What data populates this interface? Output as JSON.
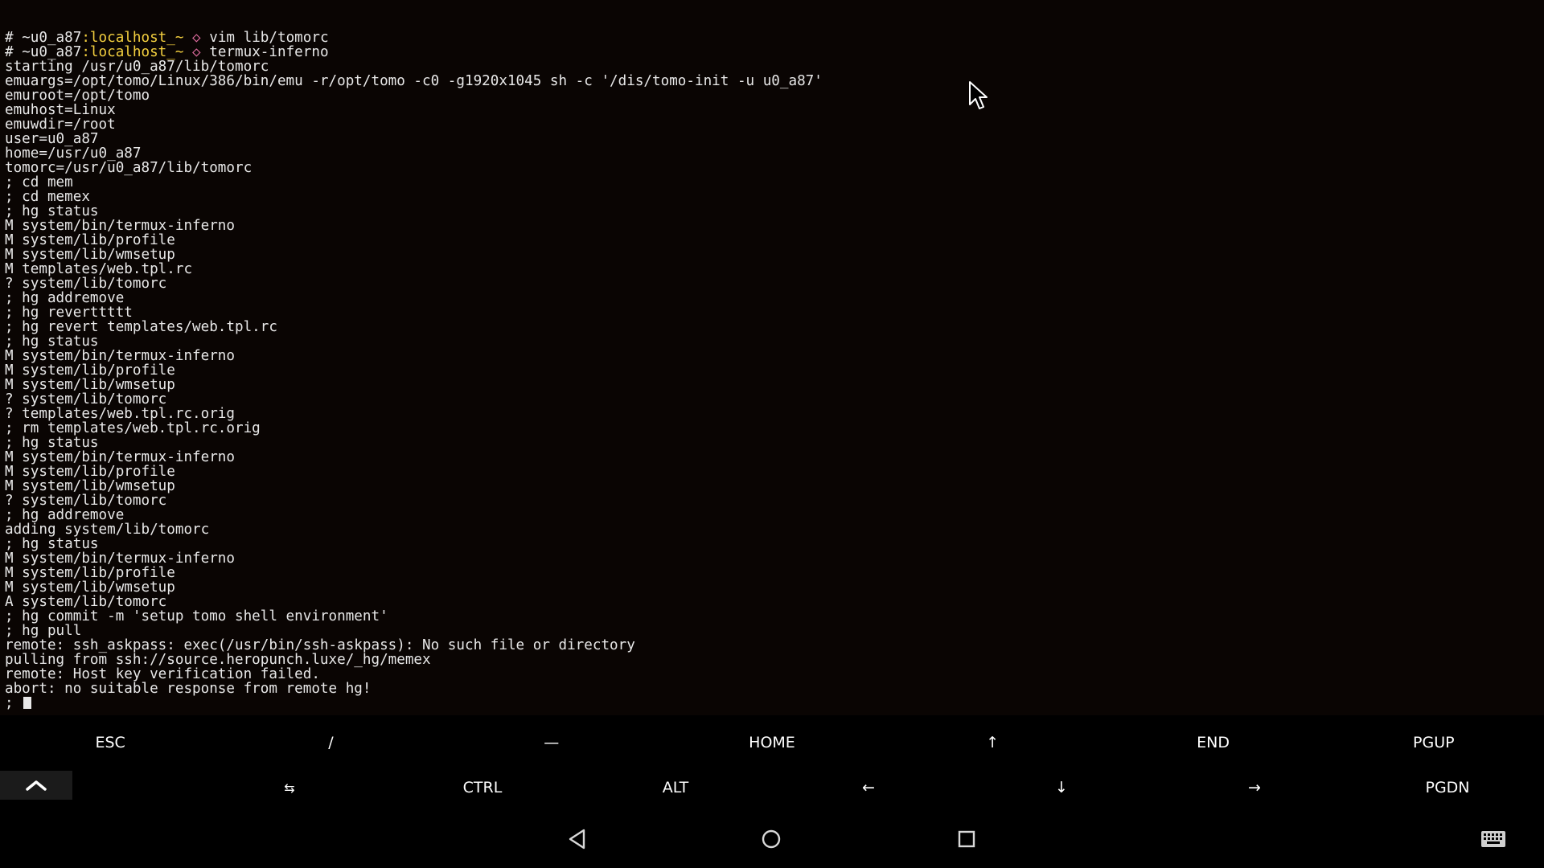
{
  "terminal": {
    "prompt_lines": [
      {
        "hash": "# ",
        "user": "~u0_a87",
        "host": ":localhost",
        "tilde": "_~",
        "sep": " ◇ ",
        "command": "vim lib/tomorc"
      },
      {
        "hash": "# ",
        "user": "~u0_a87",
        "host": ":localhost",
        "tilde": "_~",
        "sep": " ◇ ",
        "command": "termux-inferno"
      }
    ],
    "lines": [
      "starting /usr/u0_a87/lib/tomorc",
      "emuargs=/opt/tomo/Linux/386/bin/emu -r/opt/tomo -c0 -g1920x1045 sh -c '/dis/tomo-init -u u0_a87'",
      "emuroot=/opt/tomo",
      "emuhost=Linux",
      "emuwdir=/root",
      "user=u0_a87",
      "home=/usr/u0_a87",
      "tomorc=/usr/u0_a87/lib/tomorc",
      "; cd mem",
      "; cd memex",
      "; hg status",
      "M system/bin/termux-inferno",
      "M system/lib/profile",
      "M system/lib/wmsetup",
      "M templates/web.tpl.rc",
      "? system/lib/tomorc",
      "; hg addremove",
      "; hg reverttttt",
      "; hg revert templates/web.tpl.rc",
      "; hg status",
      "M system/bin/termux-inferno",
      "M system/lib/profile",
      "M system/lib/wmsetup",
      "? system/lib/tomorc",
      "? templates/web.tpl.rc.orig",
      "; rm templates/web.tpl.rc.orig",
      "; hg status",
      "M system/bin/termux-inferno",
      "M system/lib/profile",
      "M system/lib/wmsetup",
      "? system/lib/tomorc",
      "; hg addremove",
      "adding system/lib/tomorc",
      "; hg status",
      "M system/bin/termux-inferno",
      "M system/lib/profile",
      "M system/lib/wmsetup",
      "A system/lib/tomorc",
      "; hg commit -m 'setup tomo shell environment'",
      "; hg pull",
      "remote: ssh_askpass: exec(/usr/bin/ssh-askpass): No such file or directory",
      "pulling from ssh://source.heropunch.luxe/_hg/memex",
      "remote: Host key verification failed.",
      "abort: no suitable response from remote hg!"
    ],
    "current_prompt": "; "
  },
  "extra_keys": {
    "row1": [
      "ESC",
      "/",
      "—",
      "HOME",
      "↑",
      "END",
      "PGUP"
    ],
    "row2": [
      "⇆",
      "CTRL",
      "ALT",
      "←",
      "↓",
      "→",
      "PGDN"
    ]
  },
  "icons": {
    "expand": "chevron-up-icon",
    "tab": "tab-arrows-icon",
    "back": "back-triangle-icon",
    "home": "home-circle-icon",
    "recents": "recents-square-icon",
    "keyboard": "keyboard-icon",
    "pointer": "mouse-pointer-icon"
  },
  "colors": {
    "background": "#0a0503",
    "text": "#e8e8e8",
    "host": "#f4d03f",
    "separator": "#e06c9f"
  }
}
